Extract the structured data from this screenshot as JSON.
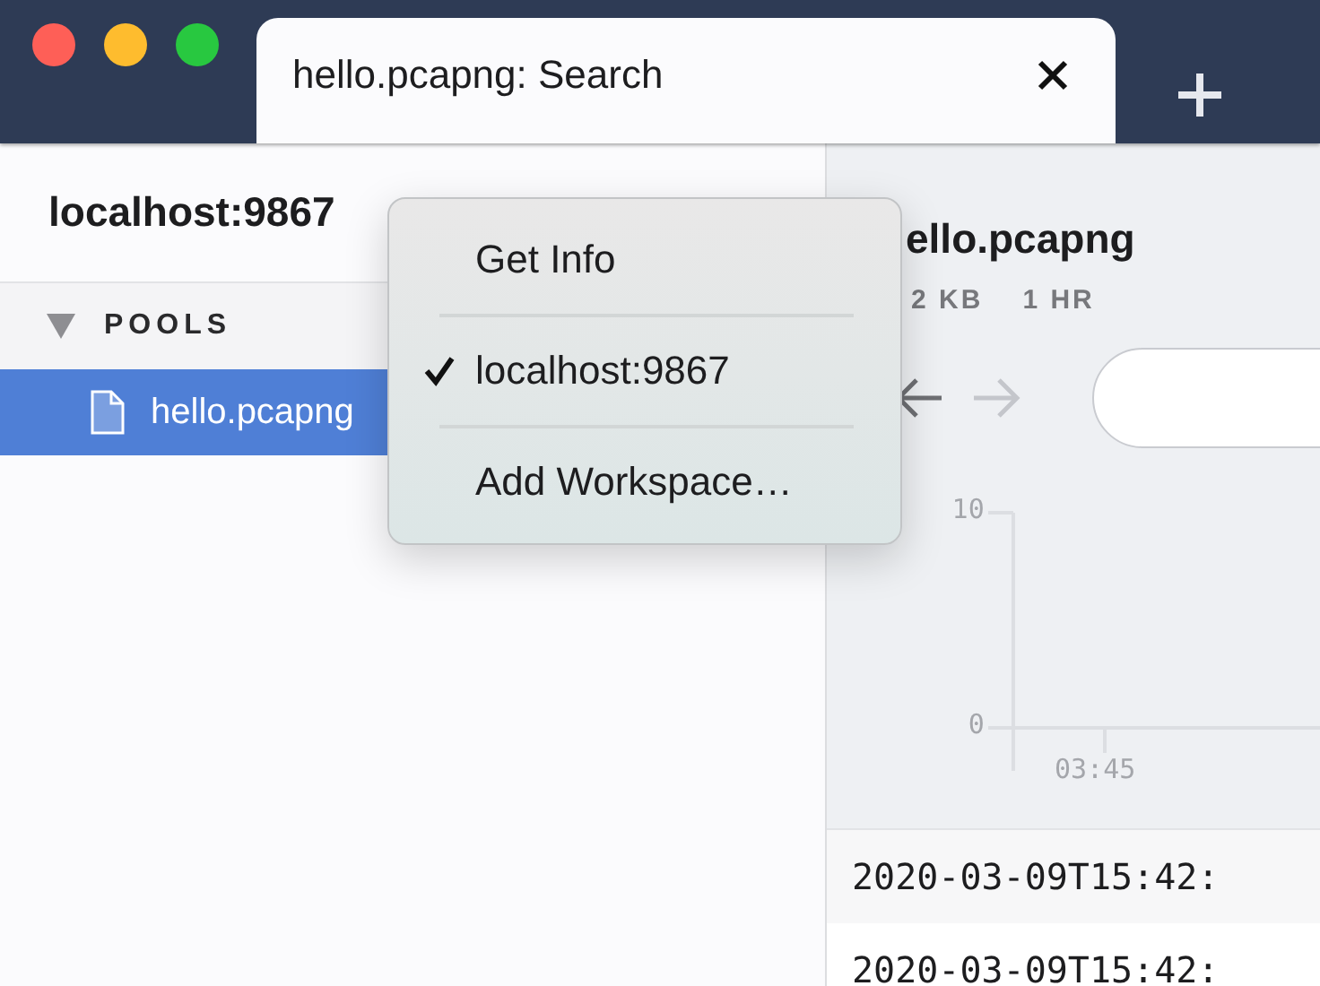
{
  "tabs": [
    {
      "label": "hello.pcapng: Search",
      "selected": true
    }
  ],
  "sidebar": {
    "title": "localhost:9867",
    "sections": [
      {
        "label": "POOLS",
        "expanded": true,
        "items": [
          {
            "label": "hello.pcapng",
            "selected": true
          }
        ]
      }
    ]
  },
  "main": {
    "title": "ello.pcapng",
    "stats": [
      "2 KB",
      "1 HR"
    ],
    "nav_buttons": [
      {
        "kind": "back",
        "disabled": false
      },
      {
        "kind": "forward",
        "disabled": true
      }
    ],
    "chart": {
      "y_ticks": [
        "10",
        "0"
      ],
      "x_ticks": [
        "03:45"
      ]
    },
    "rows": [
      {
        "time": "2020-03-09T15:42:"
      },
      {
        "time": "2020-03-09T15:42:"
      }
    ]
  },
  "context_menu": {
    "items": [
      {
        "label": "Get Info",
        "checked": false
      },
      {
        "label": "localhost:9867",
        "checked": true
      },
      {
        "label": "Add Workspace…",
        "checked": false
      }
    ]
  }
}
